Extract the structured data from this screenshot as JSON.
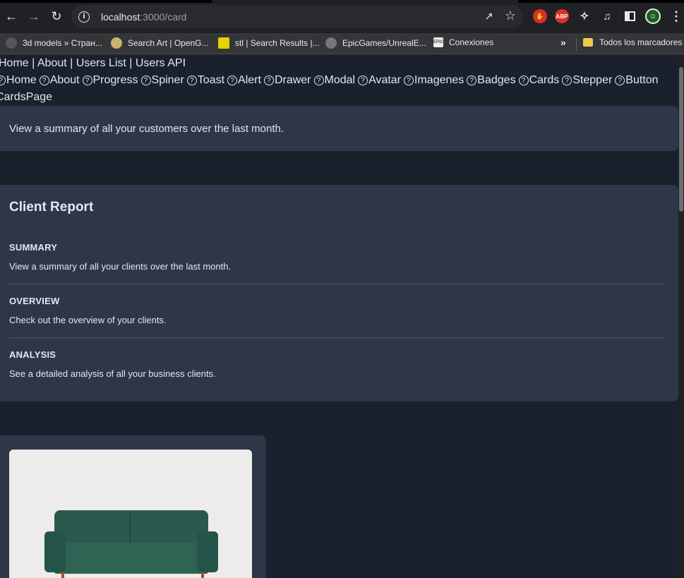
{
  "browser": {
    "url_host": "localhost",
    "url_path": ":3000/card",
    "bookmarks": [
      {
        "label": "3d models » Стран..."
      },
      {
        "label": "Search Art | OpenG..."
      },
      {
        "label": "stl | Search Results |..."
      },
      {
        "label": "EpicGames/UnrealE..."
      },
      {
        "label": "Conexiones"
      }
    ],
    "bookmarks_more": "»",
    "all_bookmarks": "Todos los marcadores",
    "abp_label": "ABP",
    "epic_label": "EPIC"
  },
  "nav": {
    "text_links": "Home | About | Users List | Users API",
    "links": [
      {
        "label": "Home"
      },
      {
        "label": "About"
      },
      {
        "label": "Progress"
      },
      {
        "label": "Spiner"
      },
      {
        "label": "Toast"
      },
      {
        "label": "Alert"
      },
      {
        "label": "Drawer"
      },
      {
        "label": "Modal"
      },
      {
        "label": "Avatar"
      },
      {
        "label": "Imagenes"
      },
      {
        "label": "Badges"
      },
      {
        "label": "Cards"
      },
      {
        "label": "Stepper"
      },
      {
        "label": "Button"
      }
    ],
    "page_name": "CardsPage"
  },
  "banner": {
    "text": "View a summary of all your customers over the last month."
  },
  "report": {
    "title": "Client Report",
    "sections": [
      {
        "heading": "Summary",
        "body": "View a summary of all your clients over the last month."
      },
      {
        "heading": "Overview",
        "body": "Check out the overview of your clients."
      },
      {
        "heading": "Analysis",
        "body": "See a detailed analysis of all your business clients."
      }
    ]
  },
  "colors": {
    "page_bg": "#1a202c",
    "card_bg": "#2d3748",
    "text": "#e2e8f0"
  }
}
